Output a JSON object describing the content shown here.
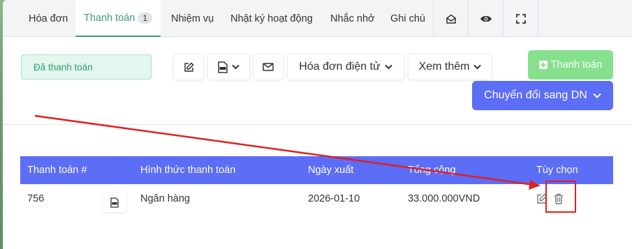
{
  "tabs": [
    {
      "label": "Hóa đơn"
    },
    {
      "label": "Thanh toán",
      "count": "1"
    },
    {
      "label": "Nhiệm vụ"
    },
    {
      "label": "Nhật ký hoạt động"
    },
    {
      "label": "Nhắc nhở"
    },
    {
      "label": "Ghi chú"
    }
  ],
  "toolbar": {
    "status": "Đã thanh toán",
    "einvoice_label": "Hóa đơn điện tử",
    "more_label": "Xem thêm",
    "pay_label": "Thanh toán",
    "convert_label": "Chuyển đổi sang DN"
  },
  "table": {
    "headers": [
      "Thanh toán #",
      "Hình thức thanh toán",
      "Ngày xuất",
      "Tổng cộng",
      "Tùy chọn"
    ],
    "rows": [
      {
        "id": "756",
        "method": "Ngân hàng",
        "date": "2026-01-10",
        "total": "33.000.000VND"
      }
    ]
  },
  "colors": {
    "accent_green": "#3a9b7e",
    "primary_blue": "#5c6df6",
    "pay_green": "#86e08e",
    "annotation_red": "#e02020"
  }
}
